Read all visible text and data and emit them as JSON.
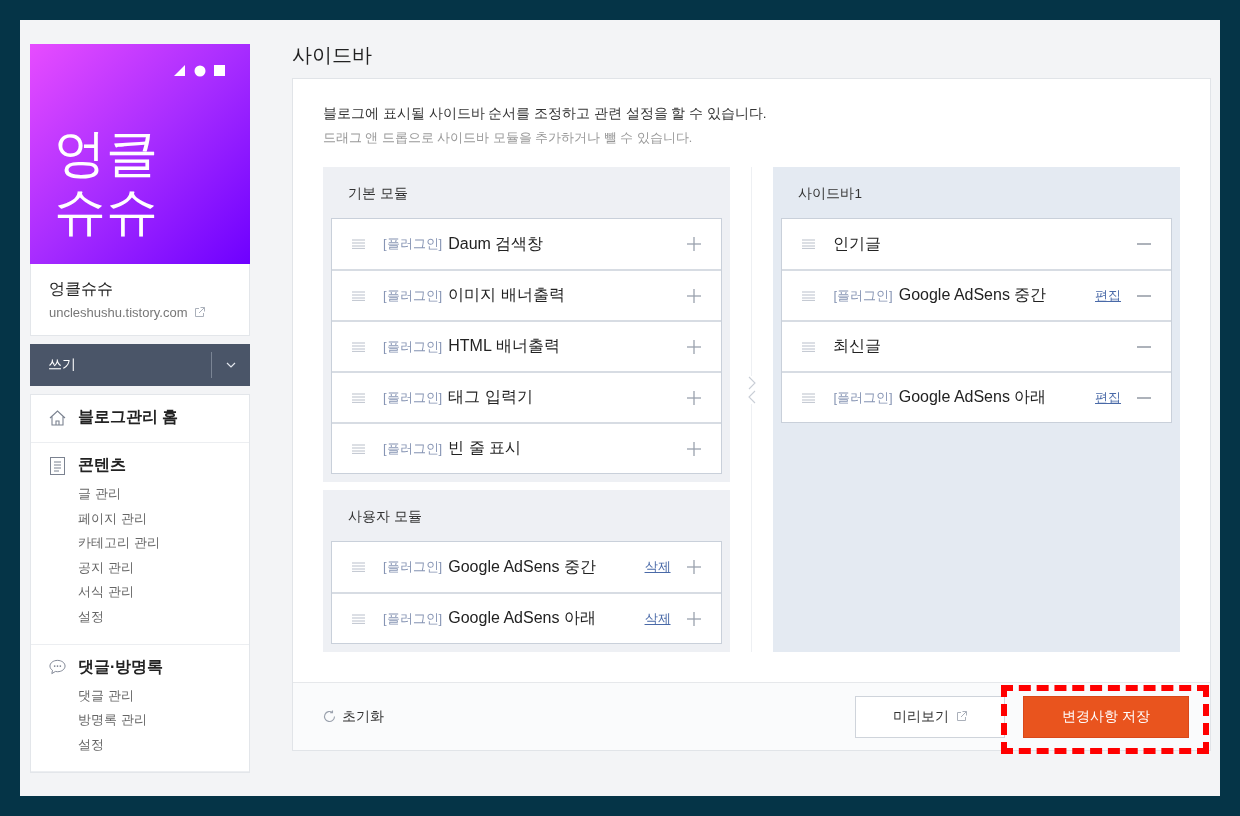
{
  "page_title": "사이드바",
  "blog": {
    "logo_lines": [
      "엉클",
      "슈슈"
    ],
    "name": "엉클슈슈",
    "url": "uncleshushu.tistory.com"
  },
  "write_button": "쓰기",
  "nav": [
    {
      "label": "블로그관리 홈",
      "kind": "home"
    },
    {
      "label": "콘텐츠",
      "kind": "document",
      "children": [
        "글 관리",
        "페이지 관리",
        "카테고리 관리",
        "공지 관리",
        "서식 관리",
        "설정"
      ]
    },
    {
      "label": "댓글·방명록",
      "kind": "comment",
      "children": [
        "댓글 관리",
        "방명록 관리",
        "설정"
      ]
    }
  ],
  "description": "블로그에 표시될 사이드바 순서를 조정하고 관련 설정을 할 수 있습니다.",
  "hint": "드래그 앤 드롭으로 사이드바 모듈을 추가하거나 뺄 수 있습니다.",
  "basic_modules": {
    "title": "기본 모듈",
    "items": [
      {
        "tag": "[플러그인]",
        "name": "Daum 검색창",
        "kind": "add"
      },
      {
        "tag": "[플러그인]",
        "name": "이미지 배너출력",
        "kind": "add"
      },
      {
        "tag": "[플러그인]",
        "name": "HTML 배너출력",
        "kind": "add"
      },
      {
        "tag": "[플러그인]",
        "name": "태그 입력기",
        "kind": "add"
      },
      {
        "tag": "[플러그인]",
        "name": "빈 줄 표시",
        "kind": "add"
      }
    ]
  },
  "user_modules": {
    "title": "사용자 모듈",
    "items": [
      {
        "tag": "[플러그인]",
        "name": "Google AdSens 중간",
        "link": "삭제",
        "kind": "add"
      },
      {
        "tag": "[플러그인]",
        "name": "Google AdSens 아래",
        "link": "삭제",
        "kind": "add"
      }
    ]
  },
  "sidebar1": {
    "title": "사이드바1",
    "items": [
      {
        "name": "인기글",
        "kind": "remove"
      },
      {
        "tag": "[플러그인]",
        "name": "Google AdSens 중간",
        "link": "편집",
        "kind": "remove"
      },
      {
        "name": "최신글",
        "kind": "remove"
      },
      {
        "tag": "[플러그인]",
        "name": "Google AdSens 아래",
        "link": "편집",
        "kind": "remove"
      }
    ]
  },
  "footer": {
    "reset": "초기화",
    "preview": "미리보기",
    "save": "변경사항 저장",
    "save_highlighted": true
  }
}
